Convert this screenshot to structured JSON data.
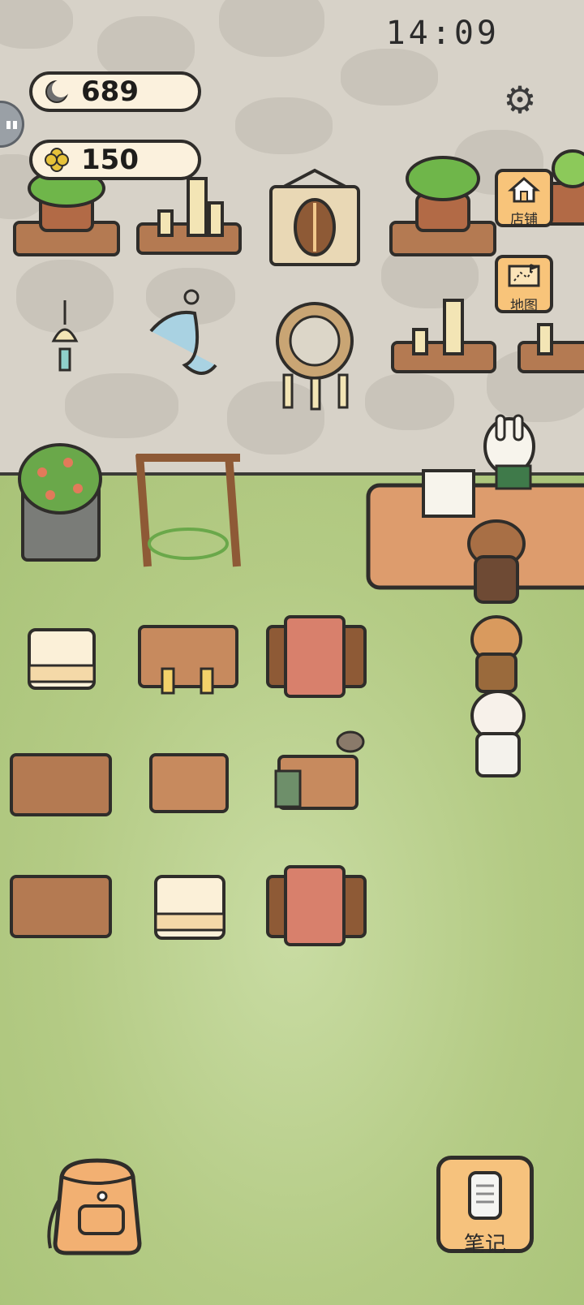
{
  "status": {
    "clock": "14:09"
  },
  "currency": {
    "moon": {
      "value": "689",
      "icon": "crescent-moon-icon"
    },
    "clover": {
      "value": "150",
      "icon": "four-leaf-clover-icon"
    }
  },
  "nav": {
    "shop_label": "店铺",
    "map_label": "地图"
  },
  "bottom": {
    "notes_label": "笔记"
  },
  "colors": {
    "wall": "#d7d2c8",
    "grass": "#b4cb85",
    "button_fill": "#f6c27d",
    "pill_fill": "#fbf1dd"
  }
}
